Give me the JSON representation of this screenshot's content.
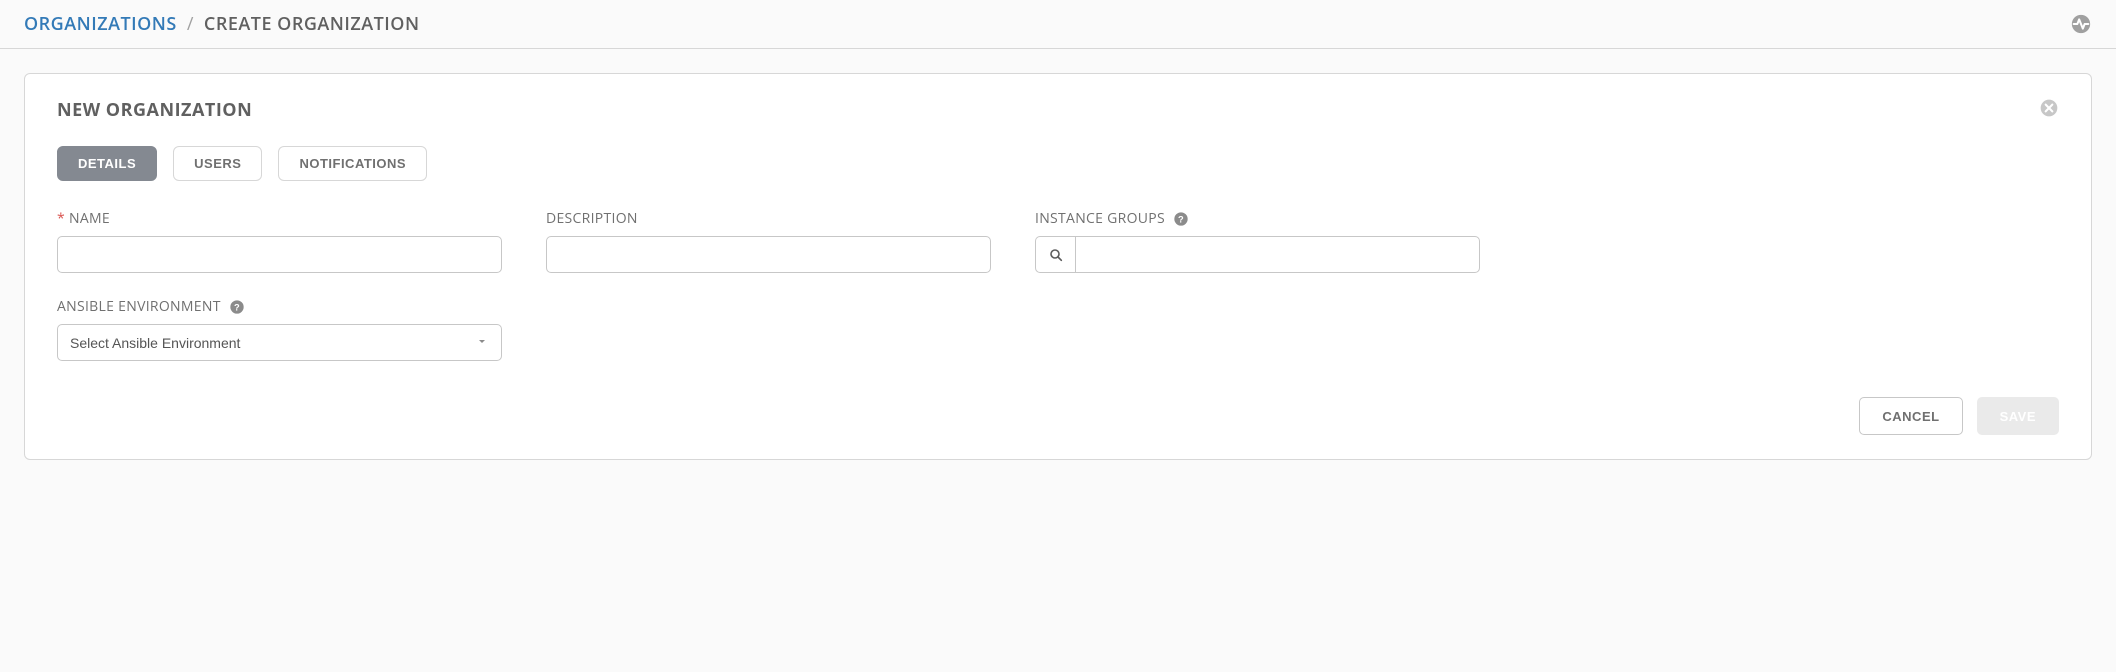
{
  "breadcrumb": {
    "root": "ORGANIZATIONS",
    "separator": "/",
    "current": "CREATE ORGANIZATION"
  },
  "panel": {
    "title": "NEW ORGANIZATION"
  },
  "tabs": {
    "details": "DETAILS",
    "users": "USERS",
    "notifications": "NOTIFICATIONS"
  },
  "fields": {
    "name_label": "NAME",
    "name_value": "",
    "description_label": "DESCRIPTION",
    "description_value": "",
    "instance_groups_label": "INSTANCE GROUPS",
    "instance_groups_value": "",
    "ansible_env_label": "ANSIBLE ENVIRONMENT",
    "ansible_env_selected": "Select Ansible Environment"
  },
  "buttons": {
    "cancel": "CANCEL",
    "save": "SAVE"
  }
}
